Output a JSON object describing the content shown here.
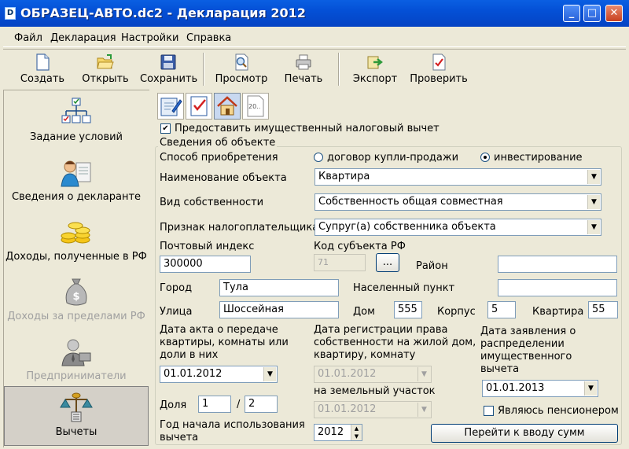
{
  "window": {
    "title": "ОБРАЗЕЦ-АВТО.dc2 - Декларация 2012",
    "icon": "D",
    "minimize": "_",
    "maximize": "□",
    "close": "✕"
  },
  "menu": [
    "Файл",
    "Декларация",
    "Настройки",
    "Справка"
  ],
  "toolbar": {
    "create": "Создать",
    "open": "Открыть",
    "save": "Сохранить",
    "preview": "Просмотр",
    "print": "Печать",
    "export": "Экспорт",
    "check": "Проверить"
  },
  "sidebar": [
    {
      "label": "Задание условий",
      "icon": "tree-diagram-icon"
    },
    {
      "label": "Сведения о декларанте",
      "icon": "person-card-icon"
    },
    {
      "label": "Доходы, полученные в РФ",
      "icon": "coins-icon"
    },
    {
      "label": "Доходы за пределами РФ",
      "icon": "money-bag-icon"
    },
    {
      "label": "Предприниматели",
      "icon": "businessman-icon"
    },
    {
      "label": "Вычеты",
      "icon": "scales-icon"
    }
  ],
  "tabs": {
    "tab4_text": "20.."
  },
  "deduction_checkbox": {
    "label": "Предоставить имущественный налоговый вычет",
    "checked": true,
    "mark": "✔"
  },
  "object_info": {
    "group_title": "Сведения об объекте",
    "acquisition_label": "Способ приобретения",
    "acquisition_option1": "договор купли-продажи",
    "acquisition_option2": "инвестирование",
    "acquisition_selected": "инвестирование",
    "object_name_label": "Наименование объекта",
    "object_name_value": "Квартира",
    "ownership_label": "Вид собственности",
    "ownership_value": "Собственность общая совместная",
    "taxpayer_label": "Признак налогоплательщика",
    "taxpayer_value": "Супруг(а) собственника объекта",
    "postal_label": "Почтовый индекс",
    "postal_value": "300000",
    "region_code_label": "Код субъекта РФ",
    "region_code_value": "71",
    "ellipsis_button": "...",
    "district_label": "Район",
    "district_value": "",
    "city_label": "Город",
    "city_value": "Тула",
    "settlement_label": "Населенный пункт",
    "settlement_value": "",
    "street_label": "Улица",
    "street_value": "Шоссейная",
    "house_label": "Дом",
    "house_value": "555",
    "building_label": "Корпус",
    "building_value": "5",
    "apartment_label": "Квартира",
    "apartment_value": "55"
  },
  "dates": {
    "transfer_act_label_1": "Дата акта о передаче",
    "transfer_act_label_2": "квартиры, комнаты или",
    "transfer_act_label_3": "доли в них",
    "transfer_act_value": "01.01.2012",
    "registration_label_1": "Дата регистрации права",
    "registration_label_2": "собственности на жилой дом,",
    "registration_label_3": "квартиру, комнату",
    "registration_value": "01.01.2012",
    "land_label": "на земельный участок",
    "land_value": "01.01.2012",
    "distribution_label_1": "Дата заявления о",
    "distribution_label_2": "распределении",
    "distribution_label_3": "имущественного",
    "distribution_label_4": "вычета",
    "distribution_value": "01.01.2013"
  },
  "share": {
    "label": "Доля",
    "numerator": "1",
    "slash": "/",
    "denominator": "2"
  },
  "start_year": {
    "label_1": "Год начала использования",
    "label_2": "вычета",
    "value": "2012"
  },
  "pensioner": {
    "label": "Являюсь пенсионером",
    "checked": false
  },
  "go_to_sums_button": "Перейти к вводу сумм"
}
